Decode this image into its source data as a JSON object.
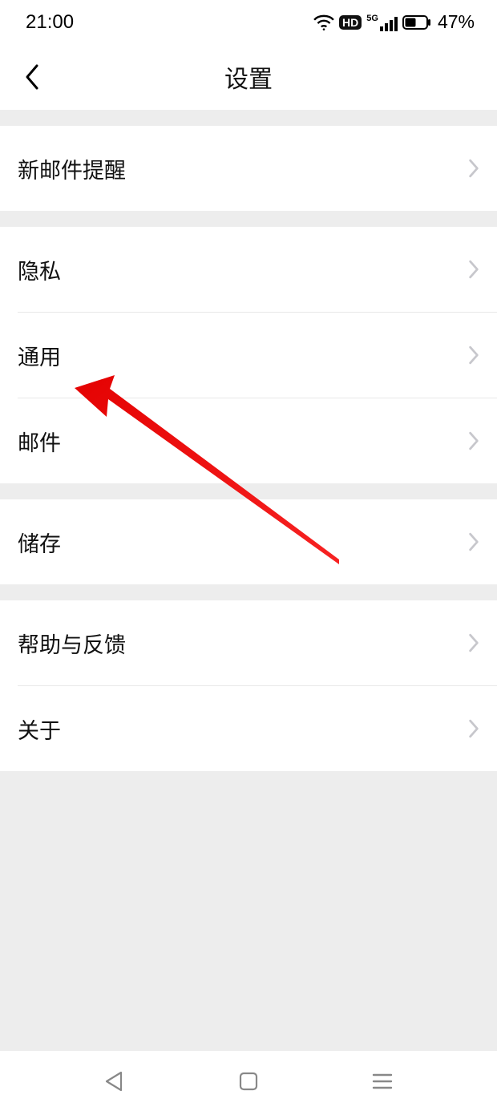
{
  "status": {
    "time": "21:00",
    "hd_label": "HD",
    "network_label": "5G",
    "battery_percent": "47%"
  },
  "header": {
    "title": "设置"
  },
  "groups": [
    {
      "items": [
        {
          "label": "新邮件提醒"
        }
      ]
    },
    {
      "items": [
        {
          "label": "隐私"
        },
        {
          "label": "通用"
        },
        {
          "label": "邮件"
        }
      ]
    },
    {
      "items": [
        {
          "label": "储存"
        }
      ]
    },
    {
      "items": [
        {
          "label": "帮助与反馈"
        },
        {
          "label": "关于"
        }
      ]
    }
  ]
}
